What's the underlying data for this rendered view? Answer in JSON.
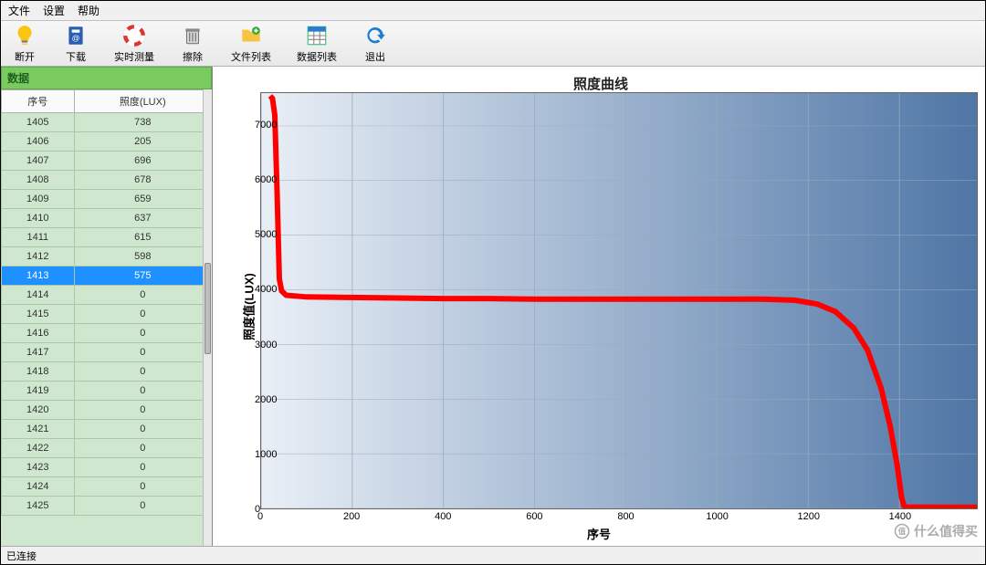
{
  "menu": {
    "file": "文件",
    "settings": "设置",
    "help": "帮助"
  },
  "toolbar": [
    {
      "name": "disconnect",
      "label": "断开",
      "icon": "bulb"
    },
    {
      "name": "download",
      "label": "下载",
      "icon": "book"
    },
    {
      "name": "realtime",
      "label": "实时测量",
      "icon": "lifebuoy"
    },
    {
      "name": "clear",
      "label": "擦除",
      "icon": "trash"
    },
    {
      "name": "filelist",
      "label": "文件列表",
      "icon": "folder"
    },
    {
      "name": "datalist",
      "label": "数据列表",
      "icon": "grid"
    },
    {
      "name": "exit",
      "label": "退出",
      "icon": "back"
    }
  ],
  "left": {
    "panel_title": "数据",
    "col_seq": "序号",
    "col_lux": "照度(LUX)",
    "selected_seq": 1413,
    "rows": [
      {
        "seq": 1405,
        "lux": 738
      },
      {
        "seq": 1406,
        "lux": 205
      },
      {
        "seq": 1407,
        "lux": 696
      },
      {
        "seq": 1408,
        "lux": 678
      },
      {
        "seq": 1409,
        "lux": 659
      },
      {
        "seq": 1410,
        "lux": 637
      },
      {
        "seq": 1411,
        "lux": 615
      },
      {
        "seq": 1412,
        "lux": 598
      },
      {
        "seq": 1413,
        "lux": 575
      },
      {
        "seq": 1414,
        "lux": 0
      },
      {
        "seq": 1415,
        "lux": 0
      },
      {
        "seq": 1416,
        "lux": 0
      },
      {
        "seq": 1417,
        "lux": 0
      },
      {
        "seq": 1418,
        "lux": 0
      },
      {
        "seq": 1419,
        "lux": 0
      },
      {
        "seq": 1420,
        "lux": 0
      },
      {
        "seq": 1421,
        "lux": 0
      },
      {
        "seq": 1422,
        "lux": 0
      },
      {
        "seq": 1423,
        "lux": 0
      },
      {
        "seq": 1424,
        "lux": 0
      },
      {
        "seq": 1425,
        "lux": 0
      }
    ]
  },
  "statusbar": {
    "status": "已连接"
  },
  "watermark": "什么值得买",
  "chart_data": {
    "type": "line",
    "title": "照度曲线",
    "xlabel": "序号",
    "ylabel": "照度值(LUX)",
    "xlim": [
      0,
      1570
    ],
    "ylim": [
      0,
      7600
    ],
    "xticks": [
      0,
      200,
      400,
      600,
      800,
      1000,
      1200,
      1400
    ],
    "yticks": [
      0,
      1000,
      2000,
      3000,
      4000,
      5000,
      6000,
      7000
    ],
    "series": [
      {
        "name": "照度",
        "color": "#ff0000",
        "points": [
          {
            "x": 20,
            "y": 7550
          },
          {
            "x": 25,
            "y": 7500
          },
          {
            "x": 30,
            "y": 7200
          },
          {
            "x": 35,
            "y": 5800
          },
          {
            "x": 40,
            "y": 4200
          },
          {
            "x": 45,
            "y": 3980
          },
          {
            "x": 55,
            "y": 3900
          },
          {
            "x": 100,
            "y": 3870
          },
          {
            "x": 200,
            "y": 3860
          },
          {
            "x": 300,
            "y": 3850
          },
          {
            "x": 400,
            "y": 3840
          },
          {
            "x": 500,
            "y": 3840
          },
          {
            "x": 600,
            "y": 3830
          },
          {
            "x": 700,
            "y": 3830
          },
          {
            "x": 800,
            "y": 3830
          },
          {
            "x": 900,
            "y": 3830
          },
          {
            "x": 1000,
            "y": 3830
          },
          {
            "x": 1100,
            "y": 3830
          },
          {
            "x": 1170,
            "y": 3810
          },
          {
            "x": 1220,
            "y": 3740
          },
          {
            "x": 1260,
            "y": 3600
          },
          {
            "x": 1300,
            "y": 3300
          },
          {
            "x": 1330,
            "y": 2900
          },
          {
            "x": 1360,
            "y": 2200
          },
          {
            "x": 1380,
            "y": 1500
          },
          {
            "x": 1395,
            "y": 800
          },
          {
            "x": 1405,
            "y": 200
          },
          {
            "x": 1410,
            "y": 50
          },
          {
            "x": 1413,
            "y": 25
          },
          {
            "x": 1500,
            "y": 20
          },
          {
            "x": 1570,
            "y": 20
          }
        ]
      }
    ]
  }
}
